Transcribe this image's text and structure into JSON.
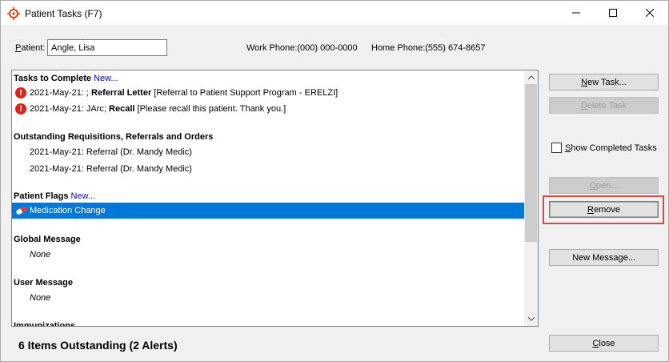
{
  "window": {
    "title": "Patient Tasks (F7)",
    "controls": {
      "minimize": "minimize",
      "maximize": "maximize",
      "close": "close"
    }
  },
  "patient": {
    "label_prefix": "P",
    "label_rest": "atient:",
    "value": "Angle, Lisa",
    "work_phone": "Work Phone:(000) 000-0000",
    "home_phone": "Home Phone:(555) 674-8657"
  },
  "list": {
    "tasks_header": "Tasks to Complete",
    "tasks_new": "New...",
    "tasks": [
      {
        "prefix": "2021-May-21: ; ",
        "bold": "Referral Letter",
        "suffix": " [Referral to Patient Support Program - ERELZI]"
      },
      {
        "prefix": "2021-May-21: JArc; ",
        "bold": "Recall",
        "suffix": " [Please recall this patient. Thank you.]"
      }
    ],
    "orders_header": "Outstanding Requisitions, Referrals and Orders",
    "orders": [
      "2021-May-21: Referral (Dr. Mandy Medic)",
      "2021-May-21: Referral (Dr. Mandy Medic)"
    ],
    "flags_header": "Patient Flags",
    "flags_new": "New...",
    "flags": [
      "Medication Change"
    ],
    "global_header": "Global Message",
    "global_value": "None",
    "user_header": "User Message",
    "user_value": "None",
    "immunizations_header": "Immunizations"
  },
  "buttons": {
    "new_task": {
      "u": "N",
      "rest": "ew Task..."
    },
    "delete_task": {
      "u": "D",
      "rest": "elete Task"
    },
    "show_completed": {
      "u": "S",
      "rest": "how Completed Tasks"
    },
    "open": {
      "u": "O",
      "rest": "pen..."
    },
    "remove": {
      "u": "R",
      "rest": "emove"
    },
    "new_message": "New Message...",
    "close": {
      "u": "C",
      "rest": "lose"
    }
  },
  "status": "6 Items Outstanding (2 Alerts)",
  "colors": {
    "selection": "#0078d7",
    "alert": "#dd2222",
    "link": "#0000cc",
    "highlight_border": "#e04848"
  }
}
